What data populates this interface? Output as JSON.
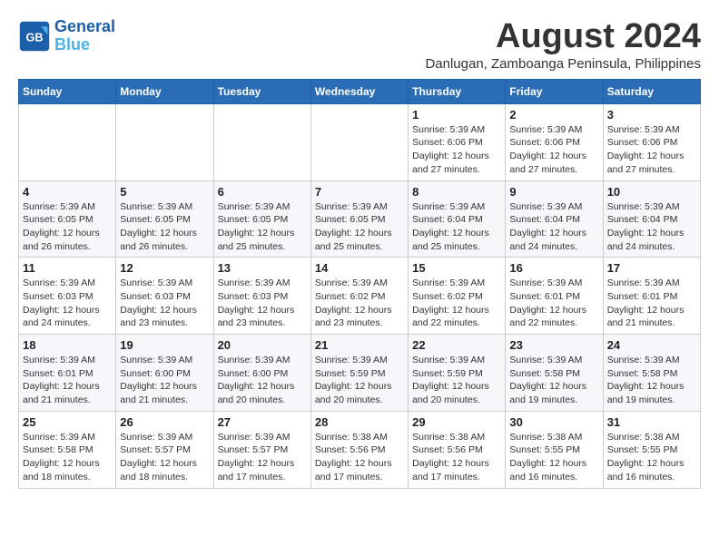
{
  "header": {
    "logo_general": "General",
    "logo_blue": "Blue",
    "main_title": "August 2024",
    "subtitle": "Danlugan, Zamboanga Peninsula, Philippines"
  },
  "calendar": {
    "days_of_week": [
      "Sunday",
      "Monday",
      "Tuesday",
      "Wednesday",
      "Thursday",
      "Friday",
      "Saturday"
    ],
    "weeks": [
      [
        {
          "day": "",
          "info": ""
        },
        {
          "day": "",
          "info": ""
        },
        {
          "day": "",
          "info": ""
        },
        {
          "day": "",
          "info": ""
        },
        {
          "day": "1",
          "info": "Sunrise: 5:39 AM\nSunset: 6:06 PM\nDaylight: 12 hours\nand 27 minutes."
        },
        {
          "day": "2",
          "info": "Sunrise: 5:39 AM\nSunset: 6:06 PM\nDaylight: 12 hours\nand 27 minutes."
        },
        {
          "day": "3",
          "info": "Sunrise: 5:39 AM\nSunset: 6:06 PM\nDaylight: 12 hours\nand 27 minutes."
        }
      ],
      [
        {
          "day": "4",
          "info": "Sunrise: 5:39 AM\nSunset: 6:05 PM\nDaylight: 12 hours\nand 26 minutes."
        },
        {
          "day": "5",
          "info": "Sunrise: 5:39 AM\nSunset: 6:05 PM\nDaylight: 12 hours\nand 26 minutes."
        },
        {
          "day": "6",
          "info": "Sunrise: 5:39 AM\nSunset: 6:05 PM\nDaylight: 12 hours\nand 25 minutes."
        },
        {
          "day": "7",
          "info": "Sunrise: 5:39 AM\nSunset: 6:05 PM\nDaylight: 12 hours\nand 25 minutes."
        },
        {
          "day": "8",
          "info": "Sunrise: 5:39 AM\nSunset: 6:04 PM\nDaylight: 12 hours\nand 25 minutes."
        },
        {
          "day": "9",
          "info": "Sunrise: 5:39 AM\nSunset: 6:04 PM\nDaylight: 12 hours\nand 24 minutes."
        },
        {
          "day": "10",
          "info": "Sunrise: 5:39 AM\nSunset: 6:04 PM\nDaylight: 12 hours\nand 24 minutes."
        }
      ],
      [
        {
          "day": "11",
          "info": "Sunrise: 5:39 AM\nSunset: 6:03 PM\nDaylight: 12 hours\nand 24 minutes."
        },
        {
          "day": "12",
          "info": "Sunrise: 5:39 AM\nSunset: 6:03 PM\nDaylight: 12 hours\nand 23 minutes."
        },
        {
          "day": "13",
          "info": "Sunrise: 5:39 AM\nSunset: 6:03 PM\nDaylight: 12 hours\nand 23 minutes."
        },
        {
          "day": "14",
          "info": "Sunrise: 5:39 AM\nSunset: 6:02 PM\nDaylight: 12 hours\nand 23 minutes."
        },
        {
          "day": "15",
          "info": "Sunrise: 5:39 AM\nSunset: 6:02 PM\nDaylight: 12 hours\nand 22 minutes."
        },
        {
          "day": "16",
          "info": "Sunrise: 5:39 AM\nSunset: 6:01 PM\nDaylight: 12 hours\nand 22 minutes."
        },
        {
          "day": "17",
          "info": "Sunrise: 5:39 AM\nSunset: 6:01 PM\nDaylight: 12 hours\nand 21 minutes."
        }
      ],
      [
        {
          "day": "18",
          "info": "Sunrise: 5:39 AM\nSunset: 6:01 PM\nDaylight: 12 hours\nand 21 minutes."
        },
        {
          "day": "19",
          "info": "Sunrise: 5:39 AM\nSunset: 6:00 PM\nDaylight: 12 hours\nand 21 minutes."
        },
        {
          "day": "20",
          "info": "Sunrise: 5:39 AM\nSunset: 6:00 PM\nDaylight: 12 hours\nand 20 minutes."
        },
        {
          "day": "21",
          "info": "Sunrise: 5:39 AM\nSunset: 5:59 PM\nDaylight: 12 hours\nand 20 minutes."
        },
        {
          "day": "22",
          "info": "Sunrise: 5:39 AM\nSunset: 5:59 PM\nDaylight: 12 hours\nand 20 minutes."
        },
        {
          "day": "23",
          "info": "Sunrise: 5:39 AM\nSunset: 5:58 PM\nDaylight: 12 hours\nand 19 minutes."
        },
        {
          "day": "24",
          "info": "Sunrise: 5:39 AM\nSunset: 5:58 PM\nDaylight: 12 hours\nand 19 minutes."
        }
      ],
      [
        {
          "day": "25",
          "info": "Sunrise: 5:39 AM\nSunset: 5:58 PM\nDaylight: 12 hours\nand 18 minutes."
        },
        {
          "day": "26",
          "info": "Sunrise: 5:39 AM\nSunset: 5:57 PM\nDaylight: 12 hours\nand 18 minutes."
        },
        {
          "day": "27",
          "info": "Sunrise: 5:39 AM\nSunset: 5:57 PM\nDaylight: 12 hours\nand 17 minutes."
        },
        {
          "day": "28",
          "info": "Sunrise: 5:38 AM\nSunset: 5:56 PM\nDaylight: 12 hours\nand 17 minutes."
        },
        {
          "day": "29",
          "info": "Sunrise: 5:38 AM\nSunset: 5:56 PM\nDaylight: 12 hours\nand 17 minutes."
        },
        {
          "day": "30",
          "info": "Sunrise: 5:38 AM\nSunset: 5:55 PM\nDaylight: 12 hours\nand 16 minutes."
        },
        {
          "day": "31",
          "info": "Sunrise: 5:38 AM\nSunset: 5:55 PM\nDaylight: 12 hours\nand 16 minutes."
        }
      ]
    ]
  }
}
